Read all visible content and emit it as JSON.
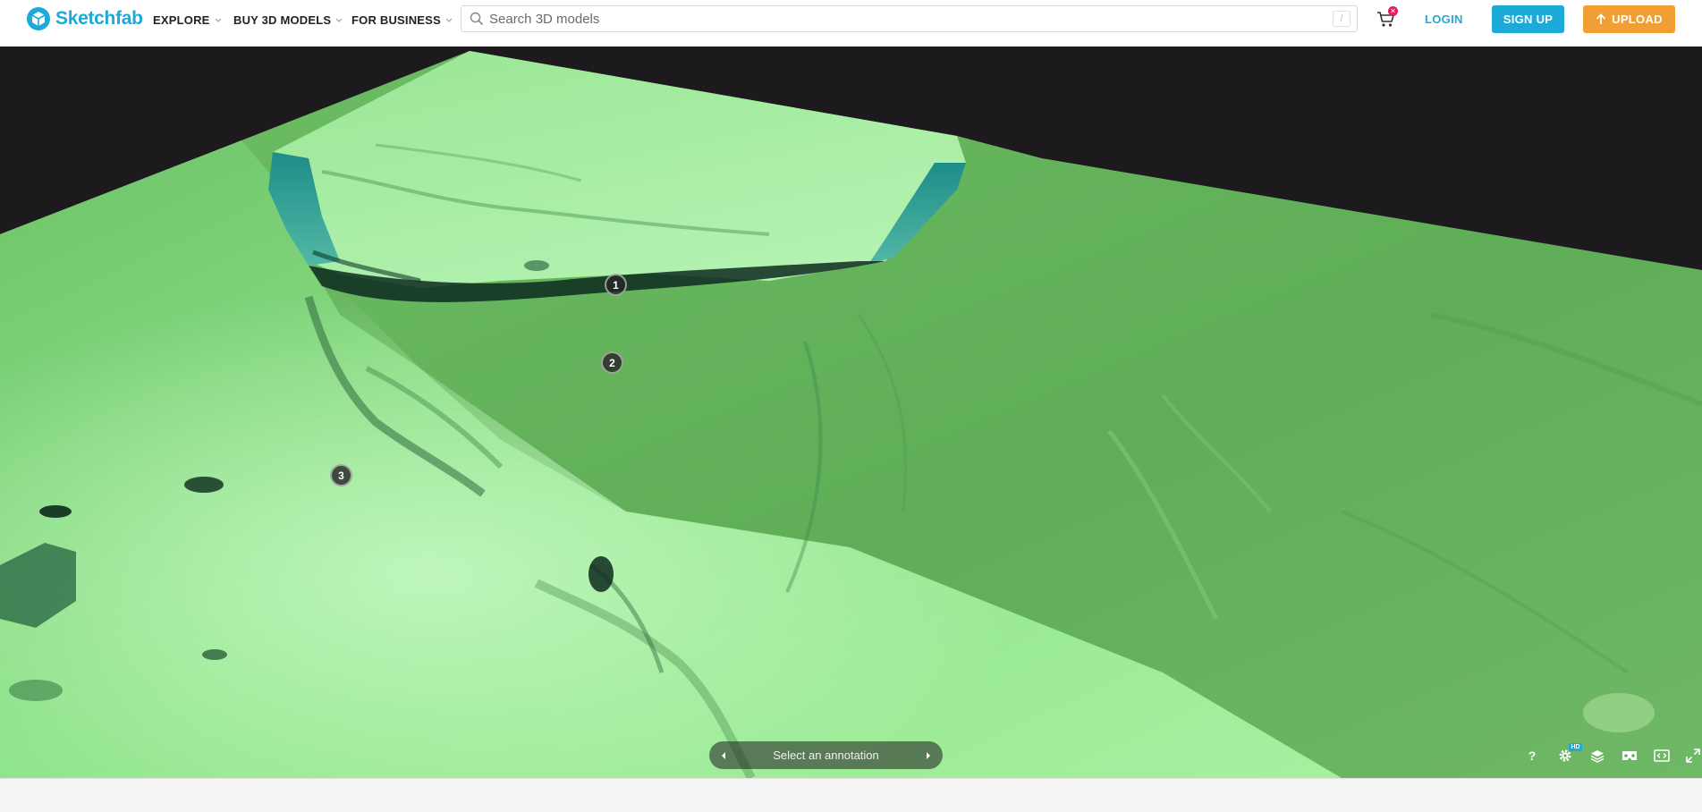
{
  "header": {
    "brand": "Sketchfab",
    "nav": [
      {
        "label": "EXPLORE"
      },
      {
        "label": "BUY 3D MODELS"
      },
      {
        "label": "FOR BUSINESS"
      }
    ],
    "search": {
      "placeholder": "Search 3D models",
      "shortcut": "/"
    },
    "cart_badge": "✕",
    "login": "LOGIN",
    "signup": "SIGN UP",
    "upload": "UPLOAD",
    "colors": {
      "brand": "#1caad9",
      "upload": "#f19f34",
      "cart_badge": "#e5195f"
    }
  },
  "viewer": {
    "hotspots": [
      {
        "label": "1"
      },
      {
        "label": "2"
      },
      {
        "label": "3"
      }
    ],
    "annotation_bar": {
      "text": "Select an annotation"
    },
    "toolbar": {
      "help": "?",
      "settings_badge": "HD",
      "icons": [
        "help-icon",
        "settings-icon",
        "layers-icon",
        "vr-icon",
        "embed-icon",
        "fullscreen-icon"
      ]
    }
  }
}
